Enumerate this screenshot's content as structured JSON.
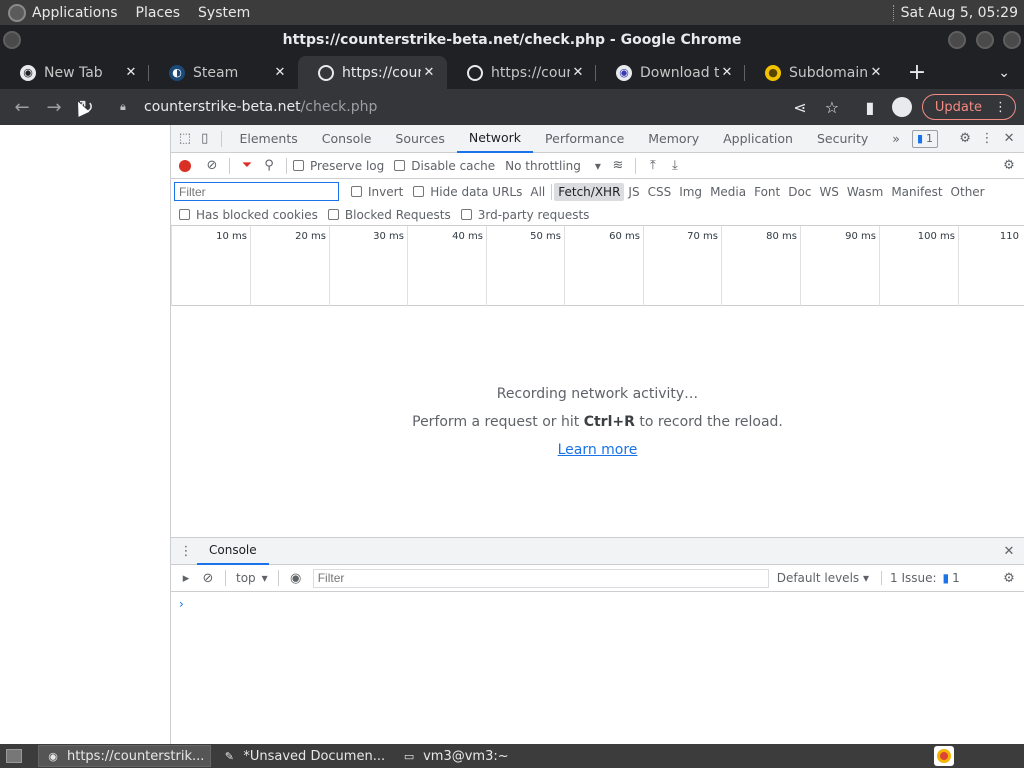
{
  "desktop": {
    "menus": [
      "Applications",
      "Places",
      "System"
    ],
    "clock": "Sat Aug  5, 05:29"
  },
  "window": {
    "title": "https://counterstrike-beta.net/check.php - Google Chrome"
  },
  "tabs": [
    {
      "label": "New Tab",
      "icon": "chrome-icon"
    },
    {
      "label": "Steam",
      "icon": "steam-icon"
    },
    {
      "label": "https://counter",
      "icon": "globe-icon",
      "active": true
    },
    {
      "label": "https://counter",
      "icon": "globe-icon"
    },
    {
      "label": "Download the",
      "icon": "eye-icon"
    },
    {
      "label": "Subdomain fin",
      "icon": "coin-icon"
    }
  ],
  "omnibox": {
    "host": "counterstrike-beta.net",
    "path": "/check.php"
  },
  "toolbar": {
    "update_label": "Update"
  },
  "devtools": {
    "tabs": [
      "Elements",
      "Console",
      "Sources",
      "Network",
      "Performance",
      "Memory",
      "Application",
      "Security"
    ],
    "more": "»",
    "issues_badge": "1",
    "network": {
      "preserve_log": "Preserve log",
      "disable_cache": "Disable cache",
      "throttling": "No throttling",
      "filter_placeholder": "Filter",
      "invert": "Invert",
      "hide_data_urls": "Hide data URLs",
      "types": [
        "All",
        "Fetch/XHR",
        "JS",
        "CSS",
        "Img",
        "Media",
        "Font",
        "Doc",
        "WS",
        "Wasm",
        "Manifest",
        "Other"
      ],
      "selected_type": "Fetch/XHR",
      "has_blocked_cookies": "Has blocked cookies",
      "blocked_requests": "Blocked Requests",
      "third_party": "3rd-party requests",
      "ticks": [
        "10 ms",
        "20 ms",
        "30 ms",
        "40 ms",
        "50 ms",
        "60 ms",
        "70 ms",
        "80 ms",
        "90 ms",
        "100 ms",
        "110"
      ],
      "empty_line1": "Recording network activity…",
      "empty_line2_pre": "Perform a request or hit ",
      "empty_line2_key": "Ctrl+R",
      "empty_line2_post": " to record the reload.",
      "learn_more": "Learn more"
    },
    "drawer": {
      "tab": "Console",
      "context": "top",
      "filter_placeholder": "Filter",
      "levels": "Default levels ▾",
      "issues": "1 Issue:",
      "issues_count": "1",
      "prompt": "›"
    }
  },
  "taskbar": {
    "items": [
      {
        "label": "https://counterstrik...",
        "active": true
      },
      {
        "label": "*Unsaved Documen...",
        "active": false
      },
      {
        "label": "vm3@vm3:~",
        "active": false
      }
    ]
  }
}
